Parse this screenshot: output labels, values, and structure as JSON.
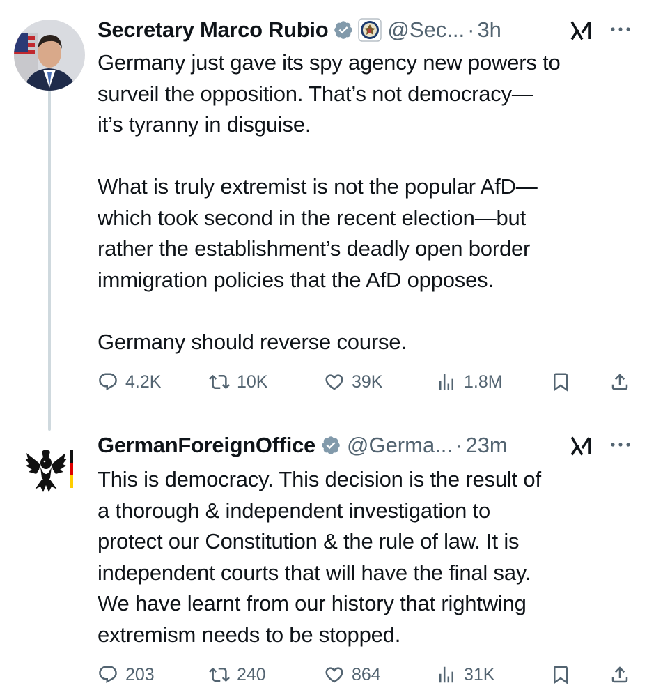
{
  "tweets": [
    {
      "name": "Secretary Marco Rubio",
      "handle": "@Sec...",
      "separator": "·",
      "time": "3h",
      "text": "Germany just gave its spy agency new powers to\nsurveil the opposition.  That’s not democracy—\nit’s tyranny in disguise.\n\nWhat is truly extremist is not the popular AfD—\nwhich took second in the recent election—but\nrather the establishment’s deadly open border\nimmigration policies that the AfD opposes.\n\nGermany should reverse course.",
      "replies": "4.2K",
      "reposts": "10K",
      "likes": "39K",
      "views": "1.8M"
    },
    {
      "name": "GermanForeignOffice",
      "handle": "@Germa...",
      "separator": "·",
      "time": "23m",
      "text": "This is democracy. This decision is the result of\na thorough & independent investigation to\nprotect our Constitution & the rule of law. It is\nindependent courts that will have the final say.\nWe have learnt from our history that rightwing\nextremism needs to be stopped.",
      "replies": "203",
      "reposts": "240",
      "likes": "864",
      "views": "31K"
    }
  ],
  "icons": {
    "verified": "verified-badge-icon",
    "affiliate": "state-department-seal-icon",
    "grok": "grok-icon",
    "more": "more-icon",
    "reply": "reply-icon",
    "repost": "repost-icon",
    "like": "like-icon",
    "views": "views-icon",
    "bookmark": "bookmark-icon",
    "share": "share-icon"
  },
  "colors": {
    "text": "#0f1419",
    "secondary": "#536471",
    "verified_badge": "#829aab",
    "thread_line": "#cfd9de"
  }
}
